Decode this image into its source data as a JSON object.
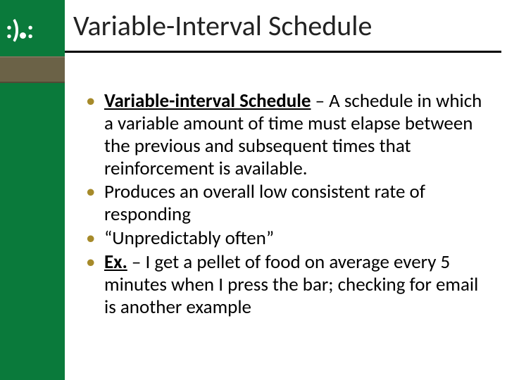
{
  "title": "Variable-Interval Schedule",
  "bullets": [
    {
      "term": "Variable-interval Schedule",
      "sep": " – ",
      "rest": "A schedule in which a variable amount of time must elapse between the previous and subsequent times that reinforcement is available."
    },
    {
      "term": "",
      "sep": "",
      "rest": "Produces an overall low consistent rate of responding"
    },
    {
      "term": "",
      "sep": "",
      "rest": "“Unpredictably often”"
    },
    {
      "term": "Ex.",
      "sep": " – ",
      "rest": "I get a pellet of food on average every 5 minutes when I press the bar; checking for email is another example"
    }
  ]
}
